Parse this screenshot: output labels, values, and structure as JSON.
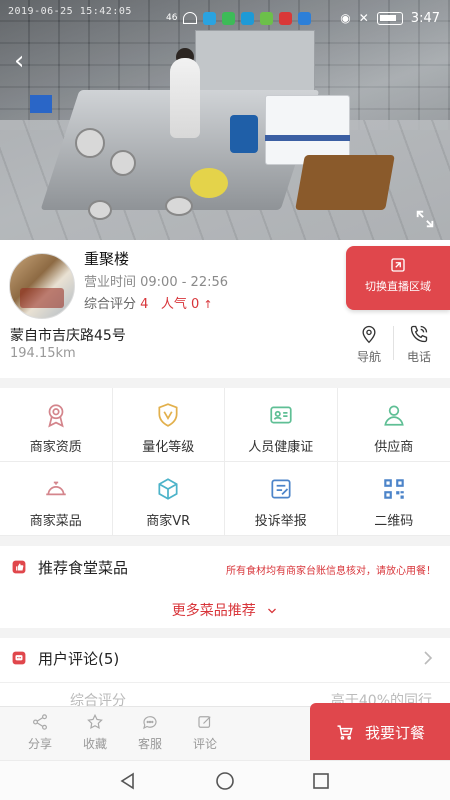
{
  "status_bar": {
    "timestamp": "2019-06-25 15:42:05",
    "time": "3:47",
    "signal": "46"
  },
  "store": {
    "name": "重聚楼",
    "hours_label": "营业时间 09:00 - 22:56",
    "rating_label": "综合评分",
    "rating_value": "4",
    "popularity_label": "人气",
    "popularity_value": "0",
    "switch_live_label": "切换直播区域",
    "address": "蒙自市吉庆路45号",
    "distance": "194.15km",
    "nav_label": "导航",
    "phone_label": "电话"
  },
  "grid": {
    "items": [
      {
        "label": "商家资质",
        "icon": "award-ribbon-icon"
      },
      {
        "label": "量化等级",
        "icon": "shield-v-icon"
      },
      {
        "label": "人员健康证",
        "icon": "id-card-icon"
      },
      {
        "label": "供应商",
        "icon": "supplier-person-icon"
      },
      {
        "label": "商家菜品",
        "icon": "dish-cloche-icon"
      },
      {
        "label": "商家VR",
        "icon": "cube-vr-icon"
      },
      {
        "label": "投诉举报",
        "icon": "complaint-edit-icon"
      },
      {
        "label": "二维码",
        "icon": "qr-code-icon"
      }
    ]
  },
  "recommend": {
    "title": "推荐食堂菜品",
    "note": "所有食材均有商家台账信息核对，请放心用餐！",
    "more_label": "更多菜品推荐"
  },
  "reviews": {
    "title": "用户评论(5)",
    "sub_left": "综合评分",
    "sub_right": "高于40%的同行"
  },
  "action_bar": {
    "share": "分享",
    "favorite": "收藏",
    "service": "客服",
    "comment": "评论",
    "order": "我要订餐"
  },
  "colors": {
    "accent": "#e0474c",
    "accent_text": "#d8353a"
  }
}
